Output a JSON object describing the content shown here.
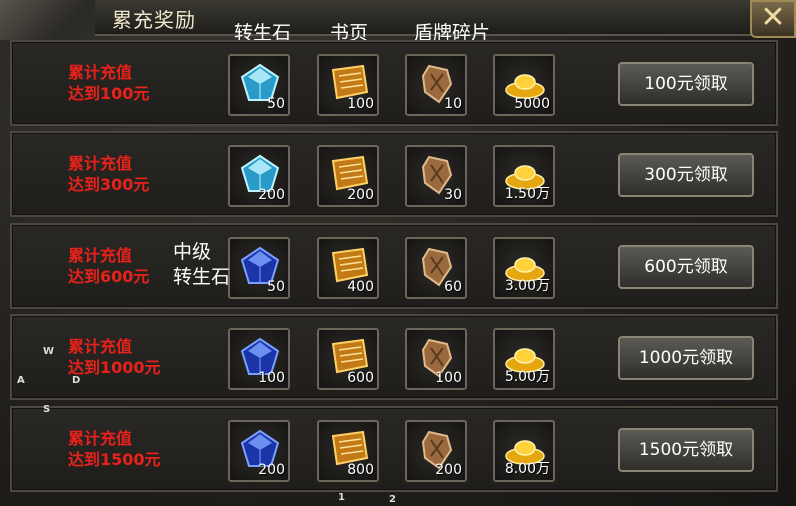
{
  "window": {
    "title": "累充奖励",
    "close_symbol": "✕"
  },
  "column_headers": [
    "转生石",
    "书页",
    "盾牌碎片"
  ],
  "overlay_label": [
    "中级",
    "转生石"
  ],
  "rows": [
    {
      "line1": "累计充值",
      "line2": "达到100元",
      "items": [
        "50",
        "100",
        "10",
        "5000"
      ],
      "button": "100元领取",
      "gem": "cyan"
    },
    {
      "line1": "累计充值",
      "line2": "达到300元",
      "items": [
        "200",
        "200",
        "30",
        "1.50万"
      ],
      "button": "300元领取",
      "gem": "cyan"
    },
    {
      "line1": "累计充值",
      "line2": "达到600元",
      "items": [
        "50",
        "400",
        "60",
        "3.00万"
      ],
      "button": "600元领取",
      "gem": "blue"
    },
    {
      "line1": "累计充值",
      "line2": "达到1000元",
      "items": [
        "100",
        "600",
        "100",
        "5.00万"
      ],
      "button": "1000元领取",
      "gem": "blue"
    },
    {
      "line1": "累计充值",
      "line2": "达到1500元",
      "items": [
        "200",
        "800",
        "200",
        "8.00万"
      ],
      "button": "1500元领取",
      "gem": "blue"
    }
  ],
  "hud_letters": {
    "w": "W",
    "a": "A",
    "d": "D",
    "s": "S",
    "one": "1",
    "two": "2"
  },
  "icons": [
    "rebirth-stone-icon",
    "book-page-icon",
    "shield-fragment-icon",
    "gold-ingot-icon"
  ],
  "colors": {
    "requirement_text": "#e8221b",
    "background": "#1b1a18",
    "button": "#4a4843"
  }
}
